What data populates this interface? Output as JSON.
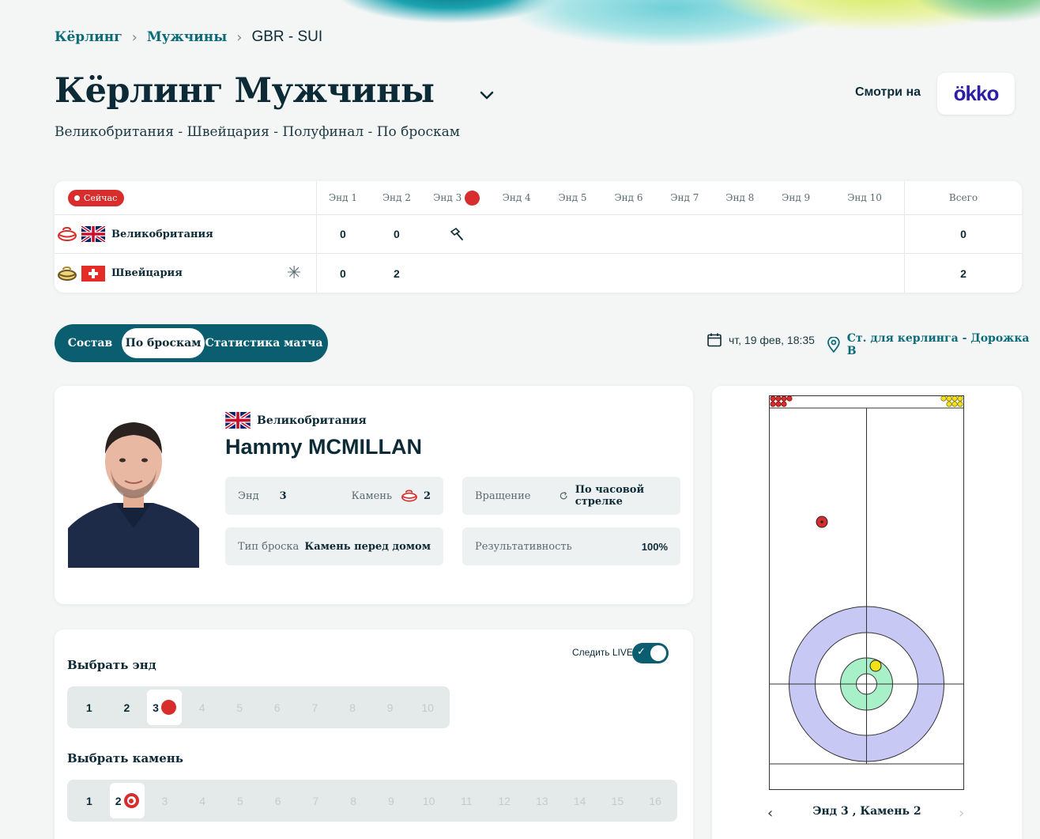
{
  "breadcrumb": {
    "item1": "Кёрлинг",
    "item2": "Мужчины",
    "current": "GBR - SUI"
  },
  "page": {
    "title": "Кёрлинг Мужчины",
    "subtitle": "Великобритания - Швейцария - Полуфинал - По броскам",
    "watch_label": "Смотри на",
    "watch_brand": "ökko"
  },
  "scoreboard": {
    "live_label": "Сейчас",
    "ends": [
      "Энд 1",
      "Энд 2",
      "Энд 3",
      "Энд 4",
      "Энд 5",
      "Энд 6",
      "Энд 7",
      "Энд 8",
      "Энд 9",
      "Энд 10"
    ],
    "total_label": "Всего",
    "current_end": 3,
    "hammer_team": "Великобритания",
    "teams": [
      {
        "name": "Великобритания",
        "stone_color": "#d72d2d",
        "scores": [
          "0",
          "0"
        ],
        "total": "0"
      },
      {
        "name": "Швейцария",
        "stone_color": "#e0b84a",
        "scores": [
          "0",
          "2"
        ],
        "total": "2",
        "marker": "✳"
      }
    ]
  },
  "tabs": {
    "lineup": "Состав",
    "by_throws": "По броскам",
    "stats": "Статистика матча",
    "active": "По броскам"
  },
  "match_meta": {
    "datetime": "чт, 19 фев, 18:35",
    "venue": "Ст. для керлинга - Дорожка B"
  },
  "player": {
    "country": "Великобритания",
    "name": "Hammy MCMILLAN",
    "end_label": "Энд",
    "end_value": "3",
    "stone_label": "Камень",
    "stone_value": "2",
    "rotation_label": "Вращение",
    "rotation_value": "По часовой стрелке",
    "shot_type_label": "Тип броска",
    "shot_type_value": "Камень перед домом",
    "performance_label": "Результативность",
    "performance_value": "100%"
  },
  "selector": {
    "end_title": "Выбрать энд",
    "stone_title": "Выбрать камень",
    "follow_live_label": "Следить LIVE",
    "follow_live_on": true,
    "ends": [
      "1",
      "2",
      "3",
      "4",
      "5",
      "6",
      "7",
      "8",
      "9",
      "10"
    ],
    "active_end": "3",
    "stones": [
      "1",
      "2",
      "3",
      "4",
      "5",
      "6",
      "7",
      "8",
      "9",
      "10",
      "11",
      "12",
      "13",
      "14",
      "15",
      "16"
    ],
    "active_stone": "2"
  },
  "sheet": {
    "caption": "Энд 3 , Камень 2",
    "colors": {
      "red_stone": "#d72d2d",
      "yellow_stone": "#f2e01b",
      "outer_ring": "#c8c8f5",
      "inner_ring": "#a8f0c8"
    }
  }
}
